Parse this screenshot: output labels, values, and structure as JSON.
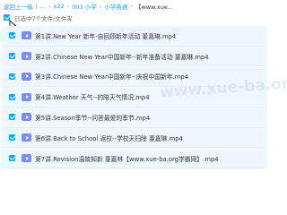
{
  "breadcrumb": {
    "back_label": "返回上一级",
    "items": [
      "...",
      "x22",
      "003 小学",
      "小学英语",
      "【www.xue..."
    ]
  },
  "selection": {
    "text": "已选中7个文件/文件夹"
  },
  "files": [
    {
      "name": "第1讲.New Year 新年-自回顾新年活动 董嘉琳.mp4"
    },
    {
      "name": "第2讲.Chinese New Year中国新年--新年准备活动 董嘉琳.mp4"
    },
    {
      "name": "第3讲.Chinese New Year中国新年--庆祝中国新年.mp4"
    },
    {
      "name": "第4讲.Weather 天气--的陪天气情况.mp4"
    },
    {
      "name": "第5讲.Season季节--问答最爱的季节.mp4"
    },
    {
      "name": "第6讲.Back to School 返校--学校天扫除 董嘉琳.mp4"
    },
    {
      "name": "第7讲.Revision温故知新 董嘉林【www.xue-ba.org学霸网】.mp4"
    }
  ],
  "watermark": {
    "text": "www.xue-ba.org"
  },
  "colors": {
    "accent": "#06a7ff",
    "row_bg": "#eef6ff",
    "video_icon": "#7b8cff"
  }
}
